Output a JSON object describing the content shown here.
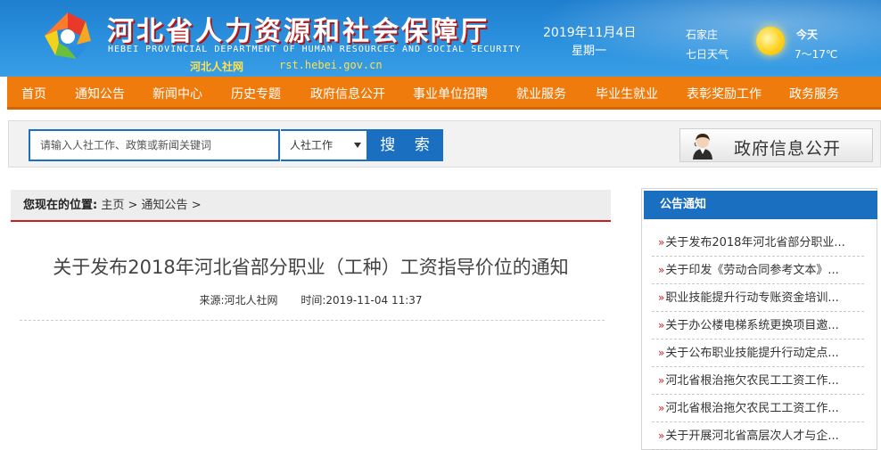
{
  "header": {
    "title": "河北省人力资源和社会保障厅",
    "title_en": "HEBEI PROVINCIAL DEPARTMENT OF HUMAN RESOURCES AND SOCIAL SECURITY",
    "short_name": "河北人社网",
    "url": "rst.hebei.gov.cn",
    "date": "2019年11月4日",
    "weekday": "星期一",
    "city": "石家庄",
    "weather_label": "七日天气",
    "today_label": "今天",
    "temperature": "7～17℃",
    "weather_icon": "sun-icon",
    "colors": {
      "header_blue": "#2b91de",
      "nav_orange": "#f07b0d",
      "accent_blue": "#1a6fc0",
      "accent_red": "#c81f1f"
    }
  },
  "nav": {
    "items": [
      {
        "label": "首页"
      },
      {
        "label": "通知公告"
      },
      {
        "label": "新闻中心"
      },
      {
        "label": "历史专题"
      },
      {
        "label": "政府信息公开"
      },
      {
        "label": "事业单位招聘"
      },
      {
        "label": "就业服务"
      },
      {
        "label": "毕业生就业"
      },
      {
        "label": "表彰奖励工作"
      },
      {
        "label": "政务服务"
      }
    ]
  },
  "search": {
    "placeholder": "请输入人社工作、政策或新闻关键词",
    "category": "人社工作",
    "button_label": "搜 索",
    "gov_info_label": "政府信息公开"
  },
  "breadcrumb": {
    "prefix": "您现在的位置:",
    "home": "主页",
    "separator": ">",
    "section": "通知公告",
    "trailing": ">"
  },
  "article": {
    "title": "关于发布2018年河北省部分职业（工种）工资指导价位的通知",
    "source": "来源:河北人社网",
    "time": "时间:2019-11-04 11:37"
  },
  "sidebar": {
    "heading": "公告通知",
    "items": [
      {
        "label": "关于发布2018年河北省部分职业..."
      },
      {
        "label": "关于印发《劳动合同参考文本》..."
      },
      {
        "label": "职业技能提升行动专账资金培训..."
      },
      {
        "label": "关于办公楼电梯系统更换项目邀..."
      },
      {
        "label": "关于公布职业技能提升行动定点..."
      },
      {
        "label": "河北省根治拖欠农民工工资工作..."
      },
      {
        "label": "河北省根治拖欠农民工工资工作..."
      },
      {
        "label": "关于开展河北省高层次人才与企..."
      }
    ]
  }
}
